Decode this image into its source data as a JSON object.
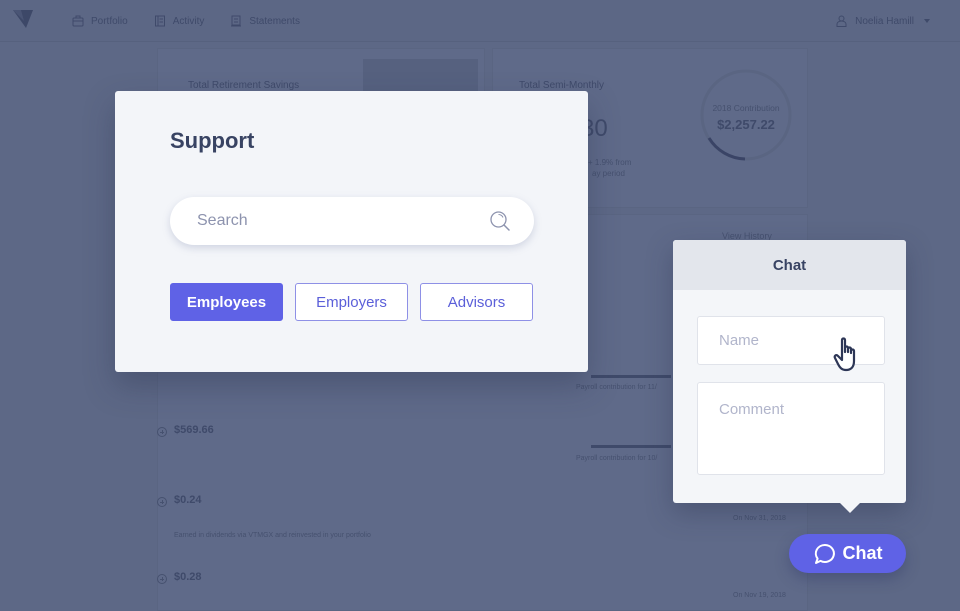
{
  "topbar": {
    "nav": [
      {
        "label": "Portfolio",
        "icon": "briefcase-icon"
      },
      {
        "label": "Activity",
        "icon": "document-list-icon"
      },
      {
        "label": "Statements",
        "icon": "statement-icon"
      }
    ],
    "user": {
      "name": "Noelia Hamill",
      "icon": "user-icon"
    }
  },
  "background": {
    "retirement_card": {
      "title": "Total Retirement Savings"
    },
    "semi_monthly_card": {
      "title": "Total Semi-Monthly",
      "amount_partial": "30",
      "change_line1": "+ 1.9% from",
      "change_line2": "ay period",
      "ring_label": "2018 Contribution",
      "ring_value": "$2,257.22"
    },
    "activity": {
      "view_history": "View History",
      "payroll_lines": [
        "Payroll contribution for 11/",
        "Payroll contribution for 10/"
      ],
      "items": [
        {
          "amount": "$569.66",
          "description": "",
          "date": ""
        },
        {
          "amount": "$0.24",
          "description": "Earned in dividends via VTMGX and reinvested in your portfolio",
          "date": "On Nov 31, 2018"
        },
        {
          "amount": "$0.28",
          "description": "",
          "date": "On Nov 19, 2018"
        }
      ]
    }
  },
  "support": {
    "title": "Support",
    "search_placeholder": "Search",
    "search_value": "",
    "segments": [
      {
        "label": "Employees",
        "active": true
      },
      {
        "label": "Employers",
        "active": false
      },
      {
        "label": "Advisors",
        "active": false
      }
    ]
  },
  "chat": {
    "title": "Chat",
    "name_placeholder": "Name",
    "comment_placeholder": "Comment",
    "fab_label": "Chat"
  },
  "colors": {
    "accent": "#5f62e6",
    "overlay": "#5d6886",
    "heading": "#384363"
  }
}
